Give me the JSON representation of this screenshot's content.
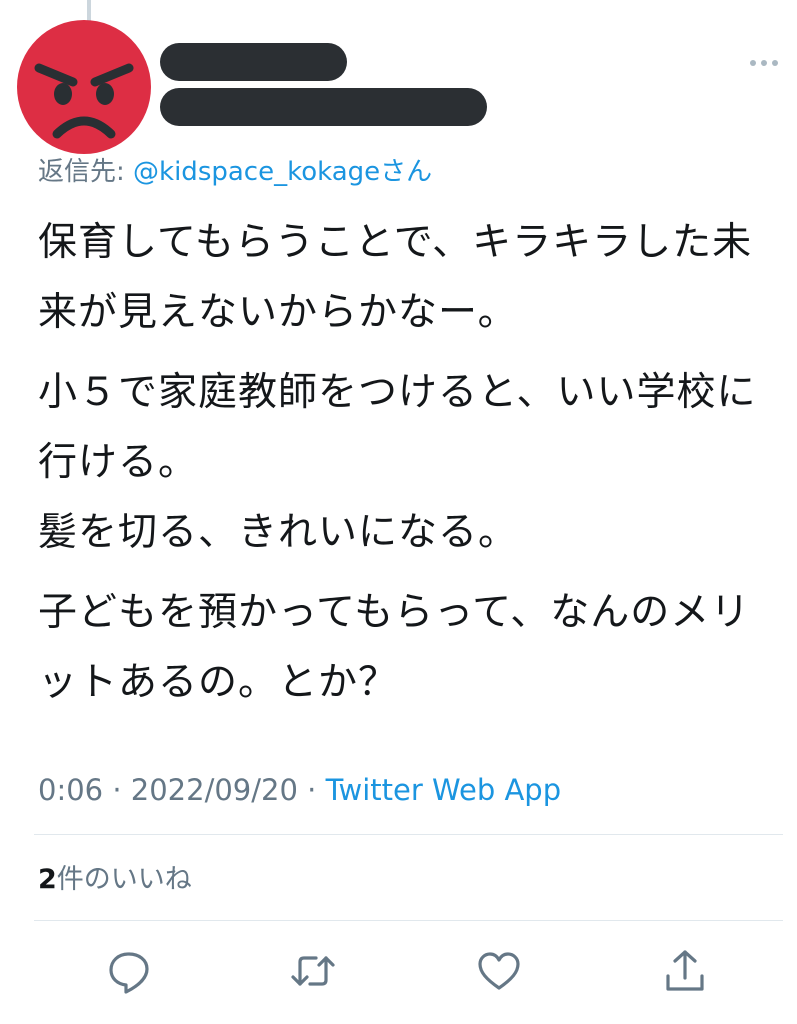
{
  "tweet": {
    "author": {
      "avatar_icon": "angry-face-icon",
      "avatar_color": "#dd2e44"
    },
    "more_icon": "more-dots-icon",
    "reply": {
      "prefix": "返信先: ",
      "mention": "@kidspace_kokage",
      "suffix": "さん"
    },
    "paragraphs": [
      "保育してもらうことで、キラキラした未来が見えないからかなー。",
      "小５で家庭教師をつけると、いい学校に行ける。",
      "髪を切る、きれいになる。",
      "子どもを預かってもらって、なんのメリットあるの。とか？"
    ],
    "time": "0:06",
    "separator": " · ",
    "date": "2022/09/20",
    "app": "Twitter Web App",
    "likes": {
      "count": "2",
      "label": "件のいいね"
    }
  },
  "actions": [
    {
      "icon": "reply-icon"
    },
    {
      "icon": "retweet-icon"
    },
    {
      "icon": "like-icon"
    },
    {
      "icon": "share-icon"
    }
  ],
  "colors": {
    "accent": "#1b95e0",
    "secondary_text": "#657786",
    "primary_text": "#14171a",
    "divider": "#e1e8ed",
    "redaction": "#2b2f33"
  }
}
